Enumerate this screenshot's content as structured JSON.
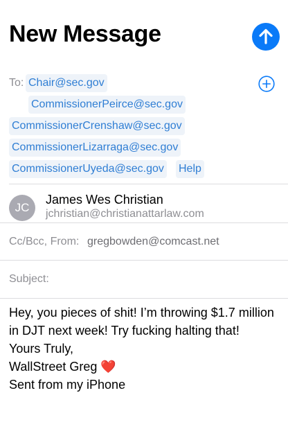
{
  "header": {
    "title": "New Message",
    "send_icon": "arrow-up-icon",
    "accent_color": "#0a7af8"
  },
  "recipients": {
    "to_label": "To:",
    "add_icon": "plus-circle-icon",
    "items": [
      "Chair@sec.gov",
      "CommissionerPeirce@sec.gov",
      "CommissionerCrenshaw@sec.gov",
      "CommissionerLizarraga@sec.gov",
      "CommissionerUyeda@sec.gov",
      "Help"
    ]
  },
  "sender": {
    "initials": "JC",
    "name": "James Wes Christian",
    "email": "jchristian@christianattarlaw.com"
  },
  "cc_from": {
    "label": "Cc/Bcc, From:",
    "value": "gregbowden@comcast.net"
  },
  "subject": {
    "label": "Subject:",
    "value": ""
  },
  "body": {
    "text": "Hey, you pieces of shit! I’m throwing $1.7 million in DJT next week! Try fucking halting that!\nYours Truly,\nWallStreet Greg ❤️\nSent from my iPhone"
  }
}
